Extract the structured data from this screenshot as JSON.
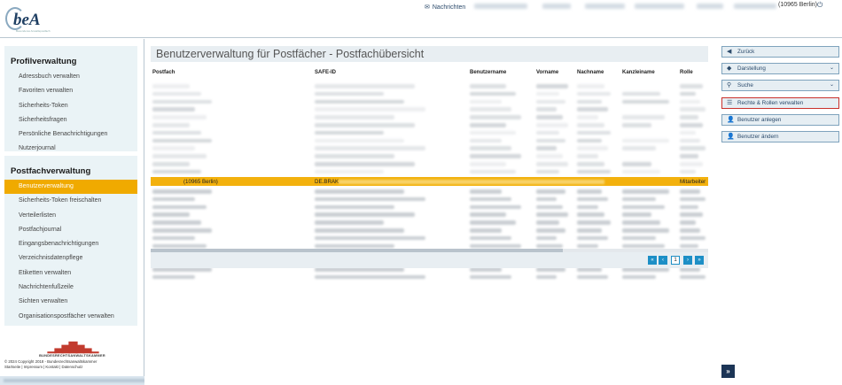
{
  "header": {
    "logo_text": "beA",
    "logo_sub": "Besonderes Anwaltspostfach",
    "messages_label": "Nachrichten",
    "user_suffix": "(10965 Berlin)"
  },
  "sidebar": {
    "profile_title": "Profilverwaltung",
    "profile_items": [
      "Adressbuch verwalten",
      "Favoriten verwalten",
      "Sicherheits-Token",
      "Sicherheitsfragen",
      "Persönliche Benachrichtigungen",
      "Nutzerjournal"
    ],
    "mailbox_title": "Postfachverwaltung",
    "mailbox_items": [
      "Benutzerverwaltung",
      "Sicherheits-Token freischalten",
      "Verteilerlisten",
      "Postfachjournal",
      "Eingangsbenachrichtigungen",
      "Verzeichnisdatenpflege",
      "Etiketten verwalten",
      "Nachrichtenfußzeile",
      "Sichten verwalten",
      "Organisationspostfächer verwalten"
    ],
    "active_item": "Benutzerverwaltung",
    "brak_name": "BUNDESRECHTSANWALTSKAMMER",
    "copyright": "© 2024 Copyright 2018 - Bundesrechtsanwaltskammer",
    "footer_links": "Startseite | Impressum | Kontakt | Datenschutz"
  },
  "main": {
    "title": "Benutzerverwaltung für Postfächer - Postfachübersicht",
    "columns": [
      "Postfach",
      "SAFE-ID",
      "Benutzername",
      "Vorname",
      "Nachname",
      "Kanzleiname",
      "Rolle"
    ],
    "highlighted_row": {
      "postfach": "(10965 Berlin)",
      "safe_id": "DE.BRAK",
      "rolle": "Mitarbeiter"
    },
    "pager": {
      "first": "«",
      "prev": "‹",
      "page": "1",
      "next": "›",
      "last": "»"
    }
  },
  "actions": {
    "back": "Zurück",
    "display": "Darstellung",
    "search": "Suche",
    "rights": "Rechte & Rollen verwalten",
    "add_user": "Benutzer anlegen",
    "edit_user": "Benutzer ändern",
    "expand": "»"
  },
  "colors": {
    "accent": "#f0aa00",
    "primary": "#1d8fc6",
    "dark": "#1c3556",
    "panel": "#eaf3f6"
  }
}
